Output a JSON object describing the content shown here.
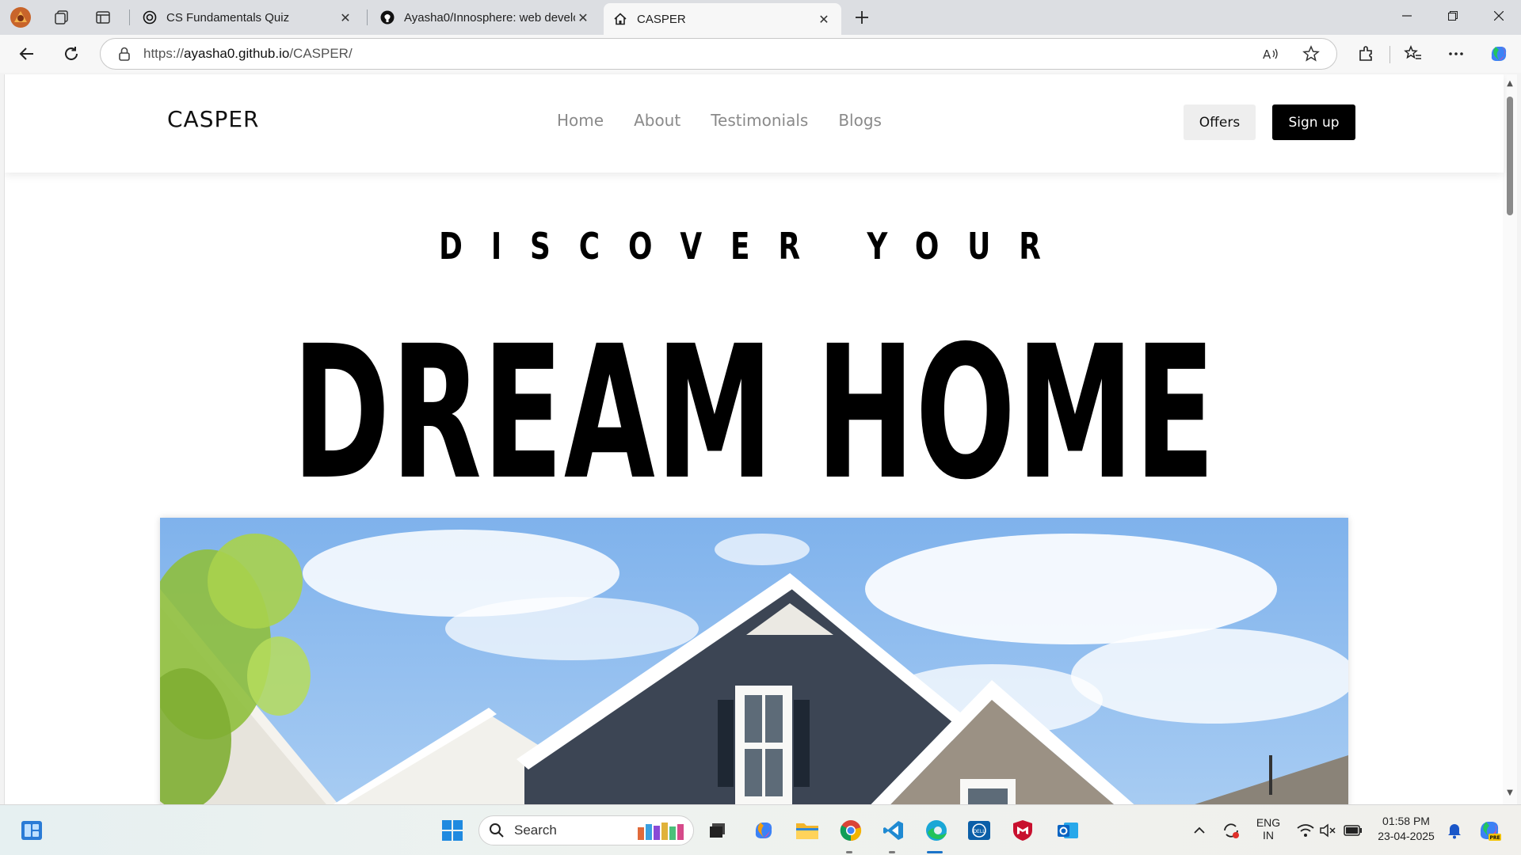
{
  "browser": {
    "tabs": [
      {
        "title": "CS Fundamentals Quiz",
        "icon": "openai-icon",
        "active": false
      },
      {
        "title": "Ayasha0/Innosphere: web develop",
        "icon": "github-icon",
        "active": false
      },
      {
        "title": "CASPER",
        "icon": "home-icon",
        "active": true
      }
    ],
    "address": {
      "prefix": "https://",
      "host": "ayasha0.github.io",
      "path": "/CASPER/"
    }
  },
  "site": {
    "brand": "CASPER",
    "nav": [
      "Home",
      "About",
      "Testimonials",
      "Blogs"
    ],
    "offers_label": "Offers",
    "signup_label": "Sign up",
    "hero_subtitle": "DISCOVER YOUR",
    "hero_title": "DREAM HOME"
  },
  "taskbar": {
    "search_label": "Search",
    "language_line1": "ENG",
    "language_line2": "IN",
    "time": "01:58 PM",
    "date": "23-04-2025"
  },
  "colors": {
    "accent": "#000000",
    "nav_text": "#8a8a8a",
    "offers_bg": "#eeeeee",
    "sky": "#8fbff0",
    "siding_dark": "#3c4554",
    "siding_tan": "#9b9184",
    "tree": "#9cc94a"
  }
}
